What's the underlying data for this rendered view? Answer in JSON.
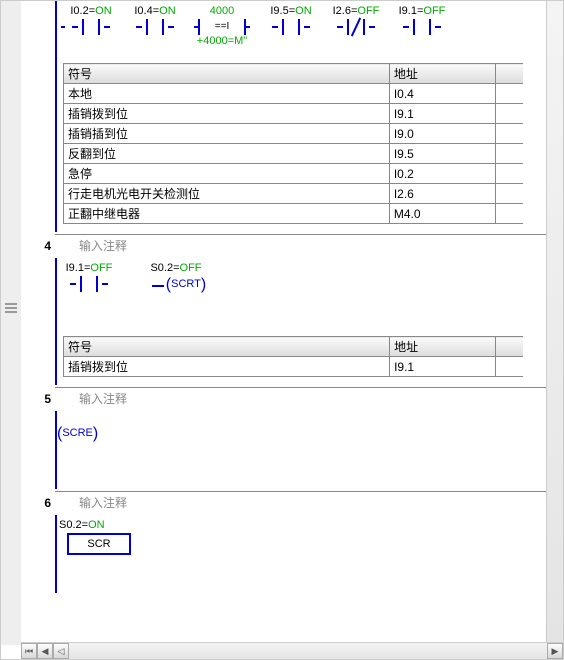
{
  "rung_top": {
    "elements": [
      {
        "addr": "I0.2",
        "state": "ON",
        "type": "no"
      },
      {
        "addr": "I0.4",
        "state": "ON",
        "type": "no"
      },
      {
        "addr": "4000",
        "cmp": "==I",
        "sub": "+4000=M\"",
        "type": "cmp"
      },
      {
        "addr": "I9.5",
        "state": "ON",
        "type": "no"
      },
      {
        "addr": "I2.6",
        "state": "OFF",
        "type": "nc"
      },
      {
        "addr": "I9.1",
        "state": "OFF",
        "type": "no"
      }
    ],
    "symbols": {
      "header_sym": "符号",
      "header_addr": "地址",
      "rows": [
        {
          "sym": "本地",
          "addr": "I0.4"
        },
        {
          "sym": "插销拨到位",
          "addr": "I9.1"
        },
        {
          "sym": "插销插到位",
          "addr": "I9.0"
        },
        {
          "sym": "反翻到位",
          "addr": "I9.5"
        },
        {
          "sym": "急停",
          "addr": "I0.2"
        },
        {
          "sym": "行走电机光电开关检测位",
          "addr": "I2.6"
        },
        {
          "sym": "正翻中继电器",
          "addr": "M4.0"
        }
      ]
    }
  },
  "rung4": {
    "num": "4",
    "comment": "输入注释",
    "c1": {
      "addr": "I9.1",
      "state": "OFF"
    },
    "c2": {
      "addr": "S0.2",
      "state": "OFF"
    },
    "coil": "SCRT",
    "symbols": {
      "header_sym": "符号",
      "header_addr": "地址",
      "rows": [
        {
          "sym": "插销拨到位",
          "addr": "I9.1"
        }
      ]
    }
  },
  "rung5": {
    "num": "5",
    "comment": "输入注释",
    "coil": "SCRE"
  },
  "rung6": {
    "num": "6",
    "comment": "输入注释",
    "c1": {
      "addr": "S0.2",
      "state": "ON"
    },
    "box": "SCR"
  }
}
